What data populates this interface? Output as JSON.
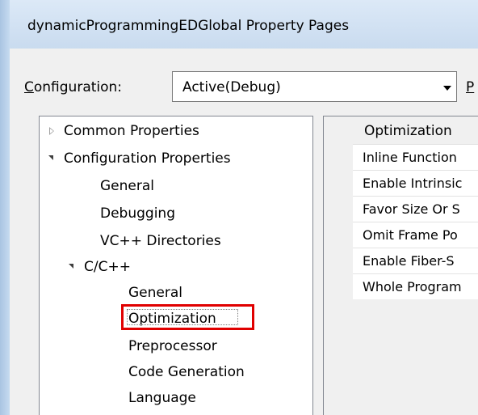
{
  "window": {
    "title": "dynamicProgrammingEDGlobal Property Pages"
  },
  "config": {
    "label_prefix": "C",
    "label_rest": "onfiguration:",
    "value": "Active(Debug)",
    "platform_label_fragment": "P"
  },
  "tree": {
    "items": [
      {
        "label": "Common Properties"
      },
      {
        "label": "Configuration Properties"
      },
      {
        "label": "General"
      },
      {
        "label": "Debugging"
      },
      {
        "label": "VC++ Directories"
      },
      {
        "label": "C/C++"
      },
      {
        "label": "General"
      },
      {
        "label": "Optimization"
      },
      {
        "label": "Preprocessor"
      },
      {
        "label": "Code Generation"
      },
      {
        "label": "Language"
      }
    ]
  },
  "grid": {
    "header": "Optimization",
    "rows": [
      {
        "label": "Inline Function"
      },
      {
        "label": "Enable Intrinsic"
      },
      {
        "label": "Favor Size Or S"
      },
      {
        "label": "Omit Frame Po"
      },
      {
        "label": "Enable Fiber-S"
      },
      {
        "label": "Whole Program"
      }
    ]
  },
  "colors": {
    "selection_highlight": "#e00000",
    "dialog_bg": "#f0f0f0",
    "title_bg": "#c9dbef"
  }
}
